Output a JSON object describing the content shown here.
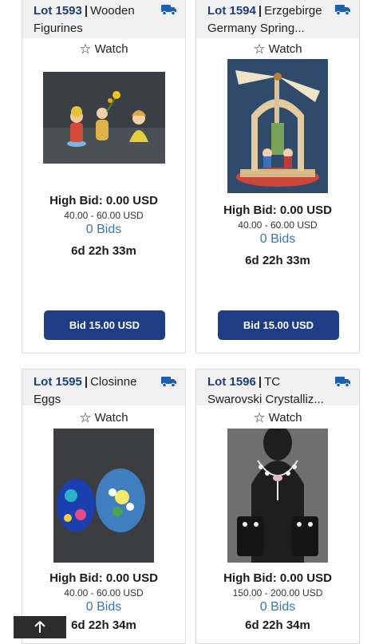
{
  "lots": [
    {
      "lot": "Lot 1593",
      "title1": "Wooden",
      "title2": "Figurines",
      "watch": "Watch",
      "high_bid": "High Bid: 0.00 USD",
      "estimate": "40.00 - 60.00 USD",
      "bids": "0 Bids",
      "time_left": "6d 22h 33m",
      "bid_button": "Bid 15.00 USD"
    },
    {
      "lot": "Lot 1594",
      "title1": "Erzgebirge",
      "title2": "Germany Spring...",
      "watch": "Watch",
      "high_bid": "High Bid: 0.00 USD",
      "estimate": "40.00 - 60.00 USD",
      "bids": "0 Bids",
      "time_left": "6d 22h 33m",
      "bid_button": "Bid 15.00 USD"
    },
    {
      "lot": "Lot 1595",
      "title1": "Closinne",
      "title2": "Eggs",
      "watch": "Watch",
      "high_bid": "High Bid: 0.00 USD",
      "estimate": "40.00 - 60.00 USD",
      "bids": "0 Bids",
      "time_left": "6d 22h 34m"
    },
    {
      "lot": "Lot 1596",
      "title1": "TC",
      "title2": "Swarovski Crystalliz...",
      "watch": "Watch",
      "high_bid": "High Bid: 0.00 USD",
      "estimate": "150.00 - 200.00 USD",
      "bids": "0 Bids",
      "time_left": "6d 22h 34m"
    }
  ],
  "back_to_top_icon": "arrow-up-icon",
  "colors": {
    "lot_link": "#1f3d7a",
    "button": "#1f3d85",
    "bids": "#3577b5"
  }
}
